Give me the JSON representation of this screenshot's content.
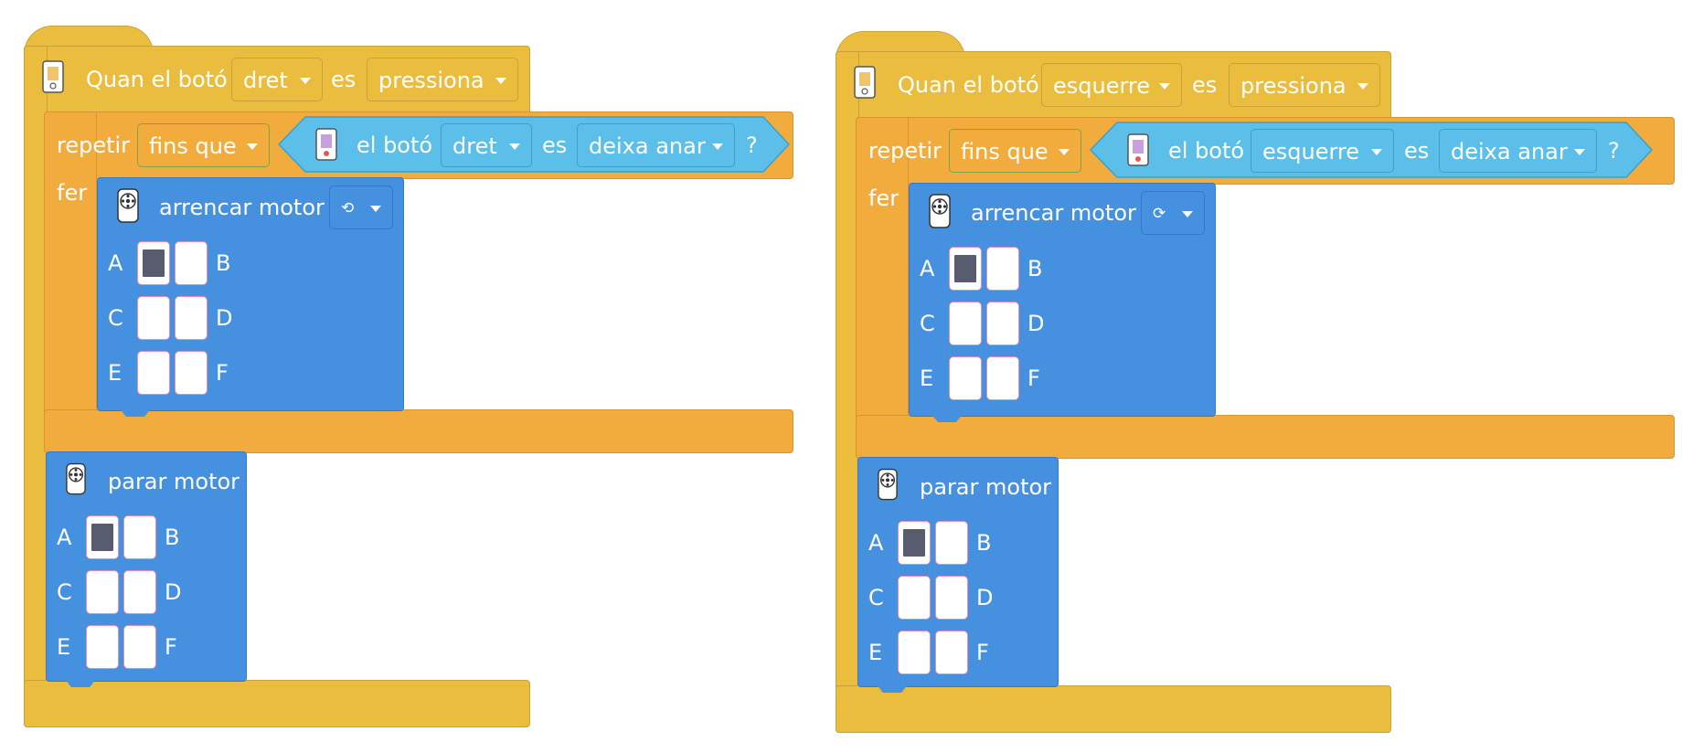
{
  "blocks": [
    {
      "hat": {
        "when_label": "Quan el botó",
        "button_value": "dret",
        "es_label": "es",
        "action_value": "pressiona"
      },
      "repeat": {
        "label": "repetir",
        "mode_value": "fins que",
        "do_label": "fer"
      },
      "condition": {
        "label": "el botó",
        "button_value": "dret",
        "es_label": "es",
        "state_value": "deixa anar",
        "question": "?"
      },
      "start_motor": {
        "label": "arrencar motor",
        "direction_value": "⟲",
        "ports": [
          {
            "name": "A",
            "on": true
          },
          {
            "name": "B",
            "on": false
          },
          {
            "name": "C",
            "on": false
          },
          {
            "name": "D",
            "on": false
          },
          {
            "name": "E",
            "on": false
          },
          {
            "name": "F",
            "on": false
          }
        ]
      },
      "stop_motor": {
        "label": "parar motor",
        "ports": [
          {
            "name": "A",
            "on": true
          },
          {
            "name": "B",
            "on": false
          },
          {
            "name": "C",
            "on": false
          },
          {
            "name": "D",
            "on": false
          },
          {
            "name": "E",
            "on": false
          },
          {
            "name": "F",
            "on": false
          }
        ]
      }
    },
    {
      "hat": {
        "when_label": "Quan el botó",
        "button_value": "esquerre",
        "es_label": "es",
        "action_value": "pressiona"
      },
      "repeat": {
        "label": "repetir",
        "mode_value": "fins que",
        "do_label": "fer"
      },
      "condition": {
        "label": "el botó",
        "button_value": "esquerre",
        "es_label": "es",
        "state_value": "deixa anar",
        "question": "?"
      },
      "start_motor": {
        "label": "arrencar motor",
        "direction_value": "⟳",
        "ports": [
          {
            "name": "A",
            "on": true
          },
          {
            "name": "B",
            "on": false
          },
          {
            "name": "C",
            "on": false
          },
          {
            "name": "D",
            "on": false
          },
          {
            "name": "E",
            "on": false
          },
          {
            "name": "F",
            "on": false
          }
        ]
      },
      "stop_motor": {
        "label": "parar motor",
        "ports": [
          {
            "name": "A",
            "on": true
          },
          {
            "name": "B",
            "on": false
          },
          {
            "name": "C",
            "on": false
          },
          {
            "name": "D",
            "on": false
          },
          {
            "name": "E",
            "on": false
          },
          {
            "name": "F",
            "on": false
          }
        ]
      }
    }
  ],
  "colors": {
    "event_yellow": "#ebbd3f",
    "control_orange": "#f2ac3d",
    "sensing_cyan": "#5bbfe9",
    "motor_blue": "#4590df",
    "cell_on": "#595b6f"
  },
  "icons": {
    "hat": "phone-icon",
    "condition": "phone-icon",
    "motor": "motor-icon"
  }
}
